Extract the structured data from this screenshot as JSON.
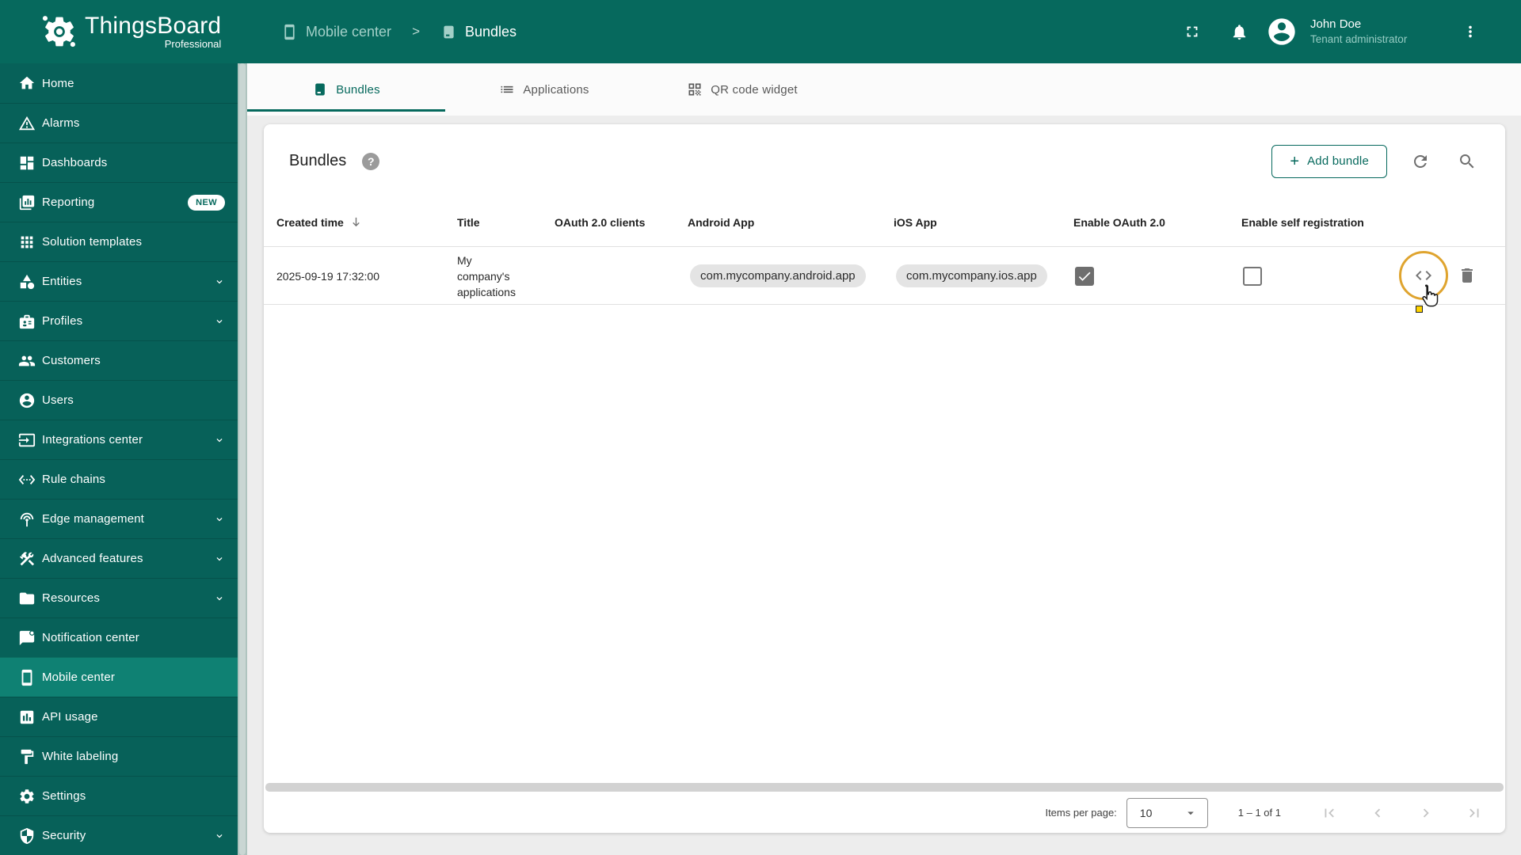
{
  "header": {
    "logo": {
      "title": "ThingsBoard",
      "subtitle": "Professional"
    },
    "breadcrumb": {
      "parent": "Mobile center",
      "separator": ">",
      "current": "Bundles"
    },
    "user": {
      "name": "John Doe",
      "role": "Tenant administrator"
    }
  },
  "sidebar": {
    "items": [
      {
        "label": "Home"
      },
      {
        "label": "Alarms"
      },
      {
        "label": "Dashboards"
      },
      {
        "label": "Reporting",
        "badge": "NEW"
      },
      {
        "label": "Solution templates"
      },
      {
        "label": "Entities",
        "expandable": true
      },
      {
        "label": "Profiles",
        "expandable": true
      },
      {
        "label": "Customers"
      },
      {
        "label": "Users"
      },
      {
        "label": "Integrations center",
        "expandable": true
      },
      {
        "label": "Rule chains"
      },
      {
        "label": "Edge management",
        "expandable": true
      },
      {
        "label": "Advanced features",
        "expandable": true
      },
      {
        "label": "Resources",
        "expandable": true
      },
      {
        "label": "Notification center"
      },
      {
        "label": "Mobile center",
        "active": true
      },
      {
        "label": "API usage"
      },
      {
        "label": "White labeling"
      },
      {
        "label": "Settings"
      },
      {
        "label": "Security",
        "expandable": true
      }
    ]
  },
  "tabs": [
    {
      "label": "Bundles",
      "active": true
    },
    {
      "label": "Applications"
    },
    {
      "label": "QR code widget"
    }
  ],
  "page": {
    "title": "Bundles",
    "add_button_label": "Add bundle",
    "table": {
      "columns": [
        "Created time",
        "Title",
        "OAuth 2.0 clients",
        "Android App",
        "iOS App",
        "Enable OAuth 2.0",
        "Enable self registration"
      ],
      "sorted_column": "Created time",
      "sort_direction": "desc",
      "rows": [
        {
          "created_time": "2025-09-19 17:32:00",
          "title": "My company's applications",
          "oauth_clients": "",
          "android_app": "com.mycompany.android.app",
          "ios_app": "com.mycompany.ios.app",
          "enable_oauth_2_0": true,
          "enable_self_registration": false
        }
      ]
    },
    "pagination": {
      "items_per_page_label": "Items per page:",
      "page_size": "10",
      "range_label": "1 – 1 of 1"
    }
  },
  "icons": {
    "plus": "+",
    "help": "?"
  },
  "colors": {
    "primary": "#06695d",
    "sidebar_bg": "#076159",
    "sidebar_active_bg": "#0f8173",
    "highlight_ring": "#dfa42f",
    "chip_bg": "#e4e4e4",
    "page_bg": "#ededed"
  }
}
